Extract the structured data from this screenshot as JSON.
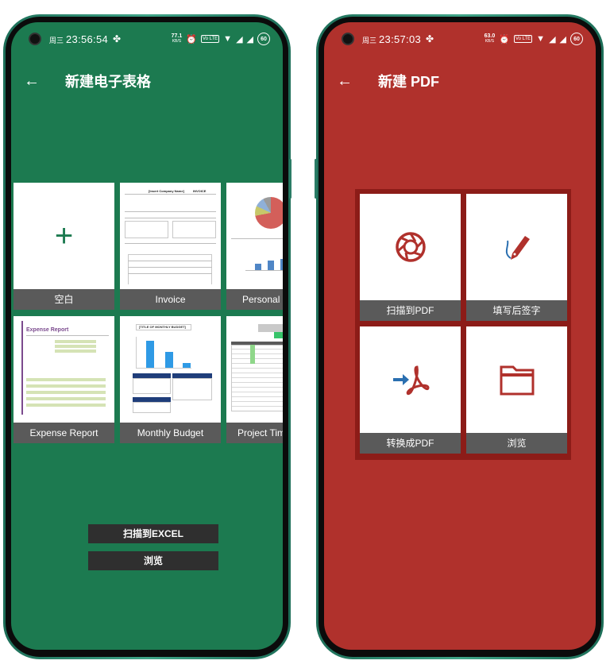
{
  "left": {
    "status": {
      "day": "周三",
      "time": "23:56:54",
      "net_value": "77.1",
      "net_unit": "KB/S",
      "battery": "60"
    },
    "title": "新建电子表格",
    "templates": [
      {
        "label": "空白"
      },
      {
        "label": "Invoice"
      },
      {
        "label": "Personal B"
      },
      {
        "label": "Expense Report"
      },
      {
        "label": "Monthly Budget"
      },
      {
        "label": "Project Tim"
      }
    ],
    "invoice_thumb": {
      "company": "[Insert Company Name]",
      "doc": "INVOICE"
    },
    "expense_thumb": {
      "title": "Expense Report"
    },
    "budget_thumb": {
      "title": "[TITLE OF MONTHLY BUDGET]"
    },
    "scan_button": "扫描到EXCEL",
    "browse_button": "浏览",
    "accent": "#1c7a50"
  },
  "right": {
    "status": {
      "day": "周三",
      "time": "23:57:03",
      "net_value": "63.0",
      "net_unit": "KB/S",
      "battery": "60"
    },
    "title": "新建 PDF",
    "actions": [
      {
        "label": "扫描到PDF",
        "icon": "camera-shutter-icon"
      },
      {
        "label": "填写后签字",
        "icon": "pen-signature-icon"
      },
      {
        "label": "转换成PDF",
        "icon": "convert-acrobat-icon"
      },
      {
        "label": "浏览",
        "icon": "folder-icon"
      }
    ],
    "accent": "#b0312c"
  }
}
